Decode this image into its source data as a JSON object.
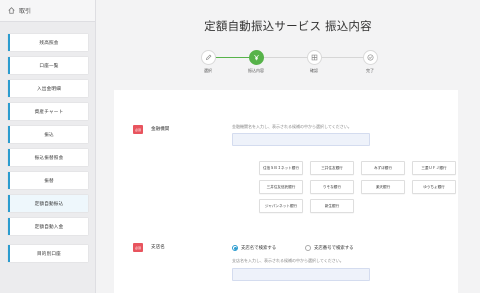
{
  "sidebar": {
    "header_label": "取引",
    "items": [
      {
        "label": "残高照会"
      },
      {
        "label": "口座一覧"
      },
      {
        "label": "入出金明細"
      },
      {
        "label": "資産チャート"
      },
      {
        "label": "振込"
      },
      {
        "label": "振込振替照会"
      },
      {
        "label": "振替"
      },
      {
        "label": "定額自動振込"
      },
      {
        "label": "定額自動入金"
      },
      {
        "label": "目的別口座"
      }
    ]
  },
  "main": {
    "title": "定額自動振込サービス 振込内容",
    "steps": [
      {
        "label": "選択"
      },
      {
        "label": "振込内容"
      },
      {
        "label": "確認"
      },
      {
        "label": "完了"
      }
    ],
    "form": {
      "bank": {
        "required_badge": "必須",
        "label": "金融機関",
        "hint": "金融機関名を入力し、表示される候補の中から選択してください。",
        "input_value": "",
        "banks": [
          "住信ＳＢＩネット銀行",
          "三井住友銀行",
          "みずほ銀行",
          "三菱ＵＦＪ銀行",
          "三井住友信託銀行",
          "りそな銀行",
          "楽天銀行",
          "ゆうちょ銀行",
          "ジャパンネット銀行",
          "新生銀行"
        ]
      },
      "branch": {
        "required_badge": "必須",
        "label": "支店名",
        "radio_name": "支店名で検索する",
        "radio_number": "支店番号で検索する",
        "hint": "支店名を入力し、表示される候補の中から選択してください。",
        "input_value": ""
      }
    }
  },
  "colors": {
    "accent": "#2c9ccf",
    "step_active": "#57b34a",
    "required": "#e8545e"
  }
}
